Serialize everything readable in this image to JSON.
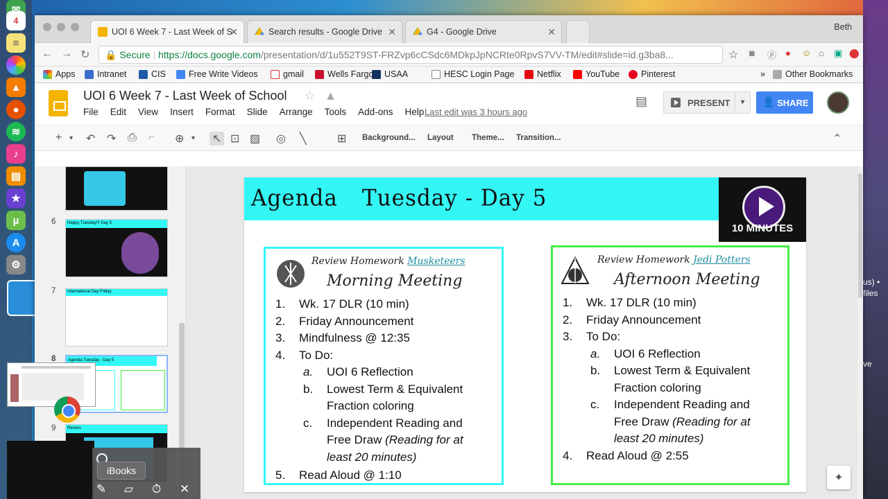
{
  "browser": {
    "tabs": [
      {
        "title": "UOI 6 Week 7 - Last Week of S",
        "icon": "slides-icon",
        "active": true
      },
      {
        "title": "Search results - Google Drive",
        "icon": "drive-icon",
        "active": false
      },
      {
        "title": "G4 - Google Drive",
        "icon": "drive-icon",
        "active": false
      }
    ],
    "user": "Beth",
    "secure_label": "Secure",
    "url_host": "https://docs.google.com",
    "url_path": "/presentation/d/1u552T9ST-FRZvp6cCSdc6MDkpJpNCRte0RpvS7VV-TM/edit#slide=id.g3ba8...",
    "bookmarks": [
      "Apps",
      "Intranet",
      "CIS",
      "Free Write Videos",
      "gmail",
      "Wells Fargo",
      "USAA",
      "HESC Login Page",
      "Netflix",
      "YouTube",
      "Pinterest"
    ],
    "other_bookmarks": "Other Bookmarks"
  },
  "docs": {
    "title": "UOI 6 Week 7 -  Last Week of School",
    "menus": [
      "File",
      "Edit",
      "View",
      "Insert",
      "Format",
      "Slide",
      "Arrange",
      "Tools",
      "Add-ons",
      "Help"
    ],
    "last_edit": "Last edit was 3 hours ago",
    "present": "PRESENT",
    "share": "SHARE"
  },
  "toolbar": {
    "background": "Background...",
    "layout": "Layout",
    "theme": "Theme...",
    "transition": "Transition..."
  },
  "filmstrip": {
    "numbers": [
      "6",
      "7",
      "8",
      "9"
    ],
    "thumb6_title": "Happy Tuesday!!!     Day 5",
    "thumb7_title": "International Day Friday",
    "thumb8_title": "Agenda      Tuesday - Day 5",
    "thumb9_title": "Recess"
  },
  "slide": {
    "agenda": "Agenda",
    "day": "Tuesday - Day 5",
    "timer_label": "10 MINUTES",
    "left": {
      "review": "Review Homework",
      "group": "Musketeers",
      "meeting": "Morning Meeting",
      "items": [
        {
          "num": "1.",
          "text": "Wk. 17 DLR (10 min)"
        },
        {
          "num": "2.",
          "text": "Friday Announcement"
        },
        {
          "num": "3.",
          "text": "Mindfulness @ 12:35"
        },
        {
          "num": "4.",
          "text": "To Do:"
        }
      ],
      "subitems": [
        {
          "num": "a.",
          "text": "UOI 6 Reflection"
        },
        {
          "num": "b.",
          "text": "Lowest Term & Equivalent"
        },
        {
          "num": "",
          "text": "Fraction coloring"
        },
        {
          "num": "c.",
          "text": "Independent Reading and"
        },
        {
          "num": "",
          "text": "Free Draw"
        },
        {
          "num": "",
          "text": "least 20 minutes)"
        }
      ],
      "reading_note": "(Reading for at",
      "last": {
        "num": "5.",
        "text": "Read Aloud @ 1:10"
      }
    },
    "right": {
      "review": "Review Homework",
      "group": "Jedi Potters",
      "meeting": "Afternoon Meeting",
      "items": [
        {
          "num": "1.",
          "text": "Wk. 17 DLR (10 min)"
        },
        {
          "num": "2.",
          "text": "Friday Announcement"
        },
        {
          "num": "3.",
          "text": "To Do:"
        }
      ],
      "subitems": [
        {
          "num": "a.",
          "text": "UOI 6 Reflection"
        },
        {
          "num": "b.",
          "text": "Lowest Term & Equivalent"
        },
        {
          "num": "",
          "text": "Fraction coloring"
        },
        {
          "num": "c.",
          "text": "Independent Reading and"
        },
        {
          "num": "",
          "text": "Free Draw"
        },
        {
          "num": "",
          "text": "least 20 minutes)"
        }
      ],
      "reading_note": "(Reading for at",
      "last": {
        "num": "4.",
        "text": "Read Aloud @ 2:55"
      }
    }
  },
  "overlay": {
    "ibooks_tip": "iBooks"
  },
  "colors": {
    "band": "#33f7f5",
    "left_border": "#33f7f5",
    "right_border": "#44ee44",
    "share": "#4285f4"
  }
}
